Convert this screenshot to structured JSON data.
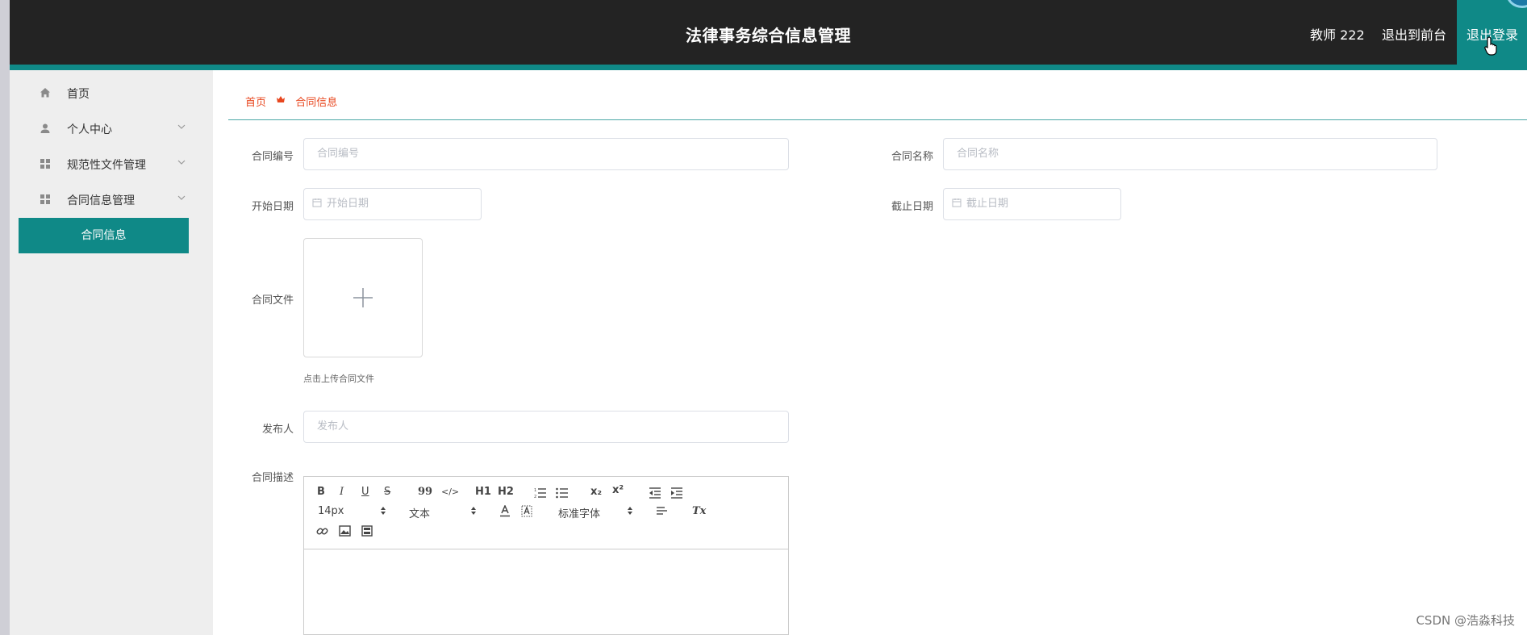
{
  "header": {
    "title": "法律事务综合信息管理",
    "user": "教师 222",
    "front_link": "退出到前台",
    "logout": "退出登录"
  },
  "sidebar": {
    "items": [
      {
        "label": "首页",
        "icon": "home-icon"
      },
      {
        "label": "个人中心",
        "icon": "user-icon"
      },
      {
        "label": "规范性文件管理",
        "icon": "grid-icon"
      },
      {
        "label": "合同信息管理",
        "icon": "grid-icon"
      }
    ],
    "active_sub": "合同信息"
  },
  "breadcrumb": {
    "home": "首页",
    "current": "合同信息"
  },
  "form": {
    "contract_no": {
      "label": "合同编号",
      "placeholder": "合同编号"
    },
    "contract_name": {
      "label": "合同名称",
      "placeholder": "合同名称"
    },
    "start_date": {
      "label": "开始日期",
      "placeholder": "开始日期"
    },
    "end_date": {
      "label": "截止日期",
      "placeholder": "截止日期"
    },
    "contract_file": {
      "label": "合同文件",
      "hint": "点击上传合同文件"
    },
    "publisher": {
      "label": "发布人",
      "placeholder": "发布人"
    },
    "description": {
      "label": "合同描述"
    }
  },
  "editor": {
    "bold": "B",
    "italic": "I",
    "underline": "U",
    "strike": "S",
    "quote": "99",
    "code": "</>",
    "h1": "H1",
    "h2": "H2",
    "sub": "x₂",
    "sup": "x²",
    "size": "14px",
    "block": "文本",
    "font": "标准字体",
    "clear": "Tx"
  },
  "watermark": "CSDN @浩淼科技",
  "colors": {
    "accent": "#0f8987",
    "header_bg": "#232323",
    "breadcrumb": "#e8471f"
  }
}
